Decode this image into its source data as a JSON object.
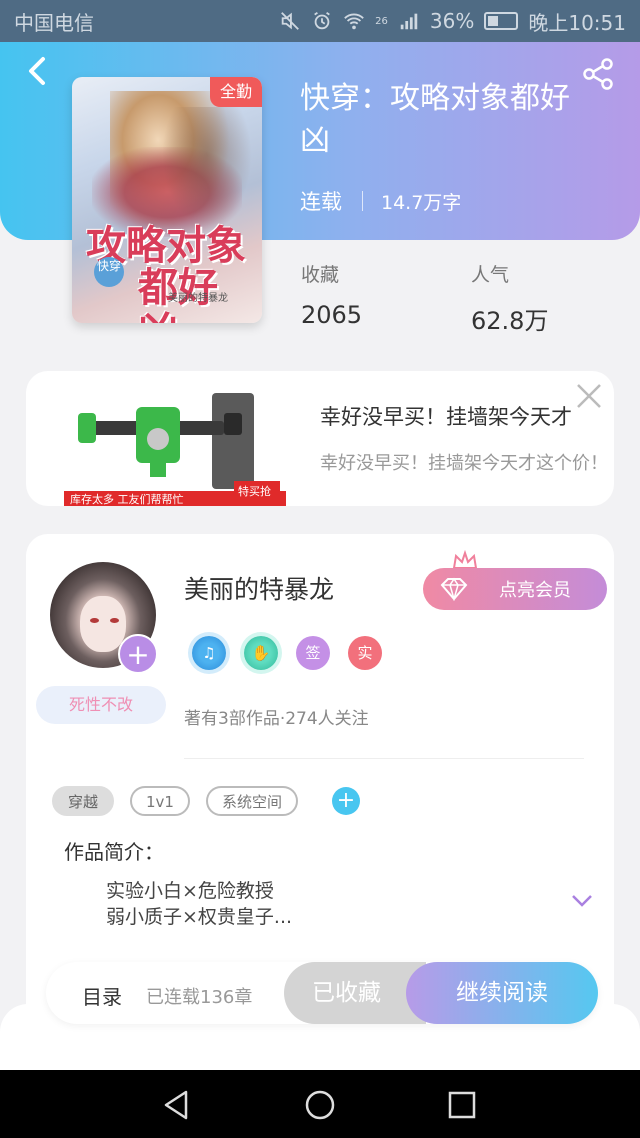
{
  "status_bar": {
    "carrier": "中国电信",
    "network": "26",
    "battery": "36%",
    "time": "晚上10:51"
  },
  "header": {
    "back_icon": "chevron-left-icon",
    "share_icon": "share-icon"
  },
  "book": {
    "badge": "全勤",
    "cover_title_line1": "攻略对象",
    "cover_title_line2": "都好凶",
    "cover_tag": "快穿",
    "cover_author": "美丽的特暴龙",
    "title": "快穿：攻略对象都好凶",
    "status": "连载",
    "word_count": "14.7万字",
    "favorites_label": "收藏",
    "favorites_value": "2065",
    "popularity_label": "人气",
    "popularity_value": "62.8万"
  },
  "ad": {
    "title": "幸好没早买！挂墙架今天才",
    "description": "幸好没早买！挂墙架今天才这个价！",
    "image_banner": "库存太多 工友们帮帮忙",
    "image_tag": "特买抢"
  },
  "author": {
    "name": "美丽的特暴龙",
    "motto": "死性不改",
    "vip_label": "点亮会员",
    "honors": [
      {
        "type": "music",
        "icon": "music-icon",
        "label": "♫"
      },
      {
        "type": "shake",
        "icon": "handshake-icon",
        "label": "✋"
      },
      {
        "type": "sign",
        "icon": "sign-icon",
        "label": "签"
      },
      {
        "type": "real",
        "icon": "verified-icon",
        "label": "实"
      }
    ],
    "stats": "著有3部作品·274人关注"
  },
  "tags": [
    "穿越",
    "1v1",
    "系统空间"
  ],
  "intro": {
    "label": "作品简介：",
    "line1": "实验小白×危险教授",
    "line2": "弱小质子×权贵皇子..."
  },
  "bottom_bar": {
    "toc_label": "目录",
    "toc_count": "已连载136章",
    "collected_label": "已收藏",
    "read_label": "继续阅读"
  },
  "colors": {
    "header_gradient_start": "#45c4f0",
    "header_gradient_end": "#b59be8",
    "vip_gradient_start": "#f08aa4",
    "vip_gradient_end": "#c48cd8",
    "read_gradient_start": "#b79be8",
    "read_gradient_end": "#55c8f0"
  }
}
